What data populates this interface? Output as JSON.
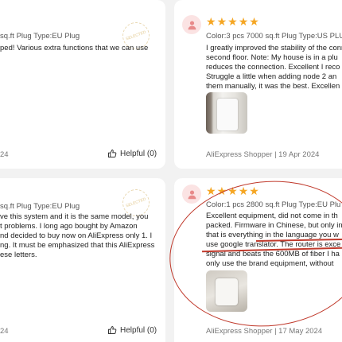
{
  "reviews": [
    {
      "variant": "sq.ft Plug Type:EU Plug",
      "lines": [
        "ped! Various extra functions that we can use"
      ],
      "footer": "24",
      "helpful": "Helpful (0)",
      "stamp": "SELECTED"
    },
    {
      "variant": "Color:3 pcs 7000 sq.ft Plug Type:US PLU",
      "lines": [
        "I greatly improved the stability of the conn",
        "second floor. Note: My house is in a plu",
        "reduces the connection. Excellent I reco",
        "Struggle a little when adding node 2 an",
        "them manually, it was the best. Excellen"
      ],
      "footer": "AliExpress Shopper | 19 Apr 2024",
      "helpful": ""
    },
    {
      "variant": "sq.ft Plug Type:EU Plug",
      "lines": [
        "ve this system and it is the same model, you",
        "t problems. I long ago bought by Amazon",
        "nd decided to buy now on AliExpress only 1. I",
        "ng. It must be emphasized that this AliExpress",
        "ese letters."
      ],
      "footer": "24",
      "helpful": "Helpful (0)",
      "stamp": "SELECTED"
    },
    {
      "variant": "Color:1 pcs 2800 sq.ft Plug Type:EU Plu",
      "lines": [
        "Excellent equipment, did not come in th",
        "packed. Firmware in Chinese, but only in",
        "that is everything in the language you w",
        "use google translator. The router is exce",
        "signal and beats the 600MB of fiber I ha",
        "only use the brand equipment, without"
      ],
      "footer": "AliExpress Shopper | 17 May 2024",
      "helpful": ""
    }
  ],
  "icons": {
    "avatar": "user-icon",
    "helpful": "thumbs-up-icon",
    "star": "star-icon"
  },
  "colors": {
    "star": "#f5a623",
    "annotation": "#c0392b",
    "avatar_bg": "#fbe3e3"
  }
}
